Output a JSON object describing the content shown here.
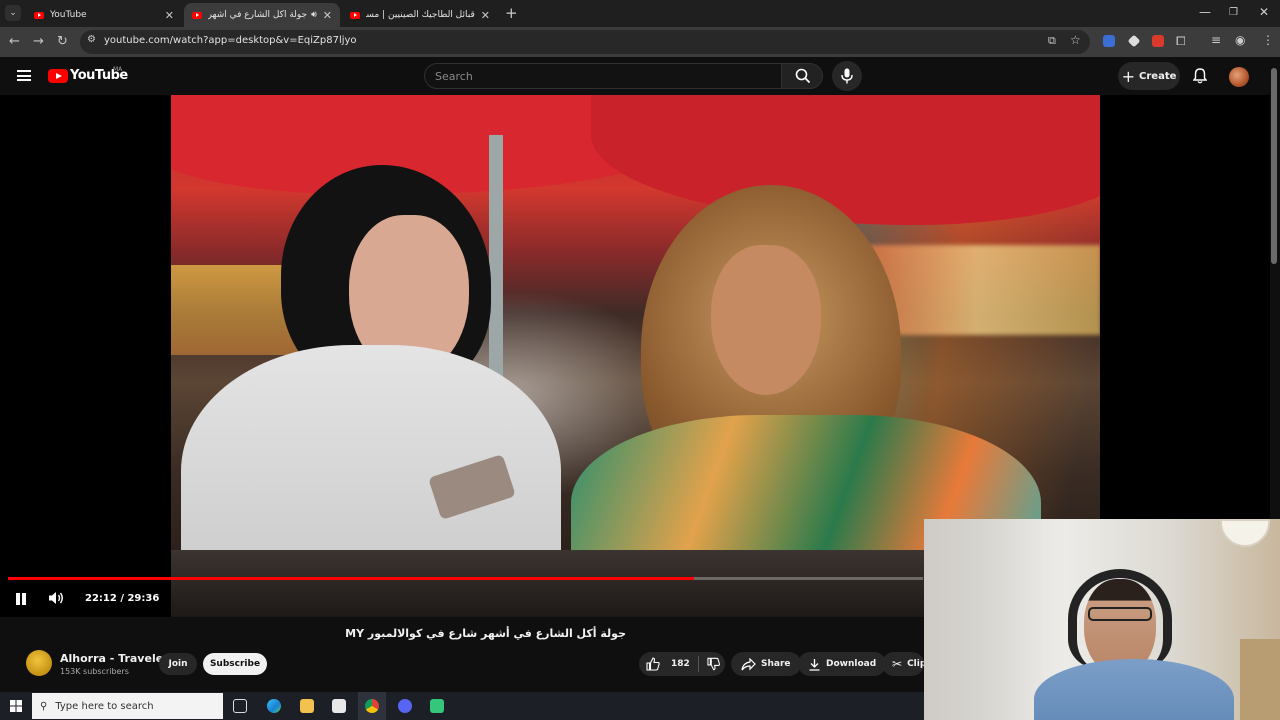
{
  "browser": {
    "tabs": [
      {
        "title": "YouTube",
        "active": false
      },
      {
        "title": "جولة أكل الشارع في أشهر شا",
        "active": true
      },
      {
        "title": "قبائل الطاجيك الصينيين | مسلمو...",
        "active": false
      }
    ],
    "new_tab_symbol": "+",
    "url": "youtube.com/watch?app=desktop&v=EqiZp87ljyo"
  },
  "youtube": {
    "logo_text": "YouTube",
    "country_code": "MA",
    "search_placeholder": "Search",
    "create_label": "Create"
  },
  "player": {
    "current_time": "22:12",
    "duration": "29:36",
    "time_display": "22:12 / 29:36",
    "progress_fraction": 0.75
  },
  "video": {
    "title": "جولة أكل الشارع في أشهر شارع في كوالالمبور MY",
    "channel_name": "Alhorra - Traveler",
    "subscribers": "153K subscribers",
    "join_label": "Join",
    "subscribe_label": "Subscribe",
    "likes": "182",
    "share_label": "Share",
    "download_label": "Download",
    "clip_label": "Clip"
  },
  "taskbar": {
    "search_placeholder": "Type here to search"
  },
  "colors": {
    "accent": "#ff0000",
    "background": "#0f0f0f",
    "chip": "#272727"
  }
}
